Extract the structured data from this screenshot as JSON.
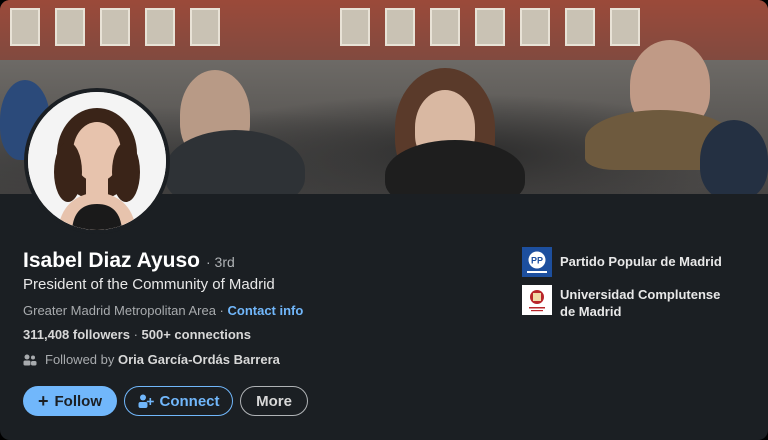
{
  "profile": {
    "name": "Isabel Diaz Ayuso",
    "degree": "· 3rd",
    "headline": "President of the Community of Madrid",
    "location": "Greater Madrid Metropolitan Area",
    "location_separator": " · ",
    "contact_info": "Contact info",
    "followers": "311,408 followers",
    "connections_separator": " · ",
    "connections": "500+ connections",
    "followed_by_prefix": "Followed by",
    "followed_by_name": "Oria García-Ordás Barrera"
  },
  "actions": {
    "follow": "Follow",
    "connect": "Connect",
    "more": "More"
  },
  "organizations": [
    {
      "name": "Partido Popular de Madrid",
      "logo": "pp-logo"
    },
    {
      "name_line1": "Universidad Complutense",
      "name_line2": "de Madrid",
      "logo": "ucm-logo"
    }
  ],
  "colors": {
    "background": "#1b1f23",
    "accent": "#71b7fb"
  }
}
